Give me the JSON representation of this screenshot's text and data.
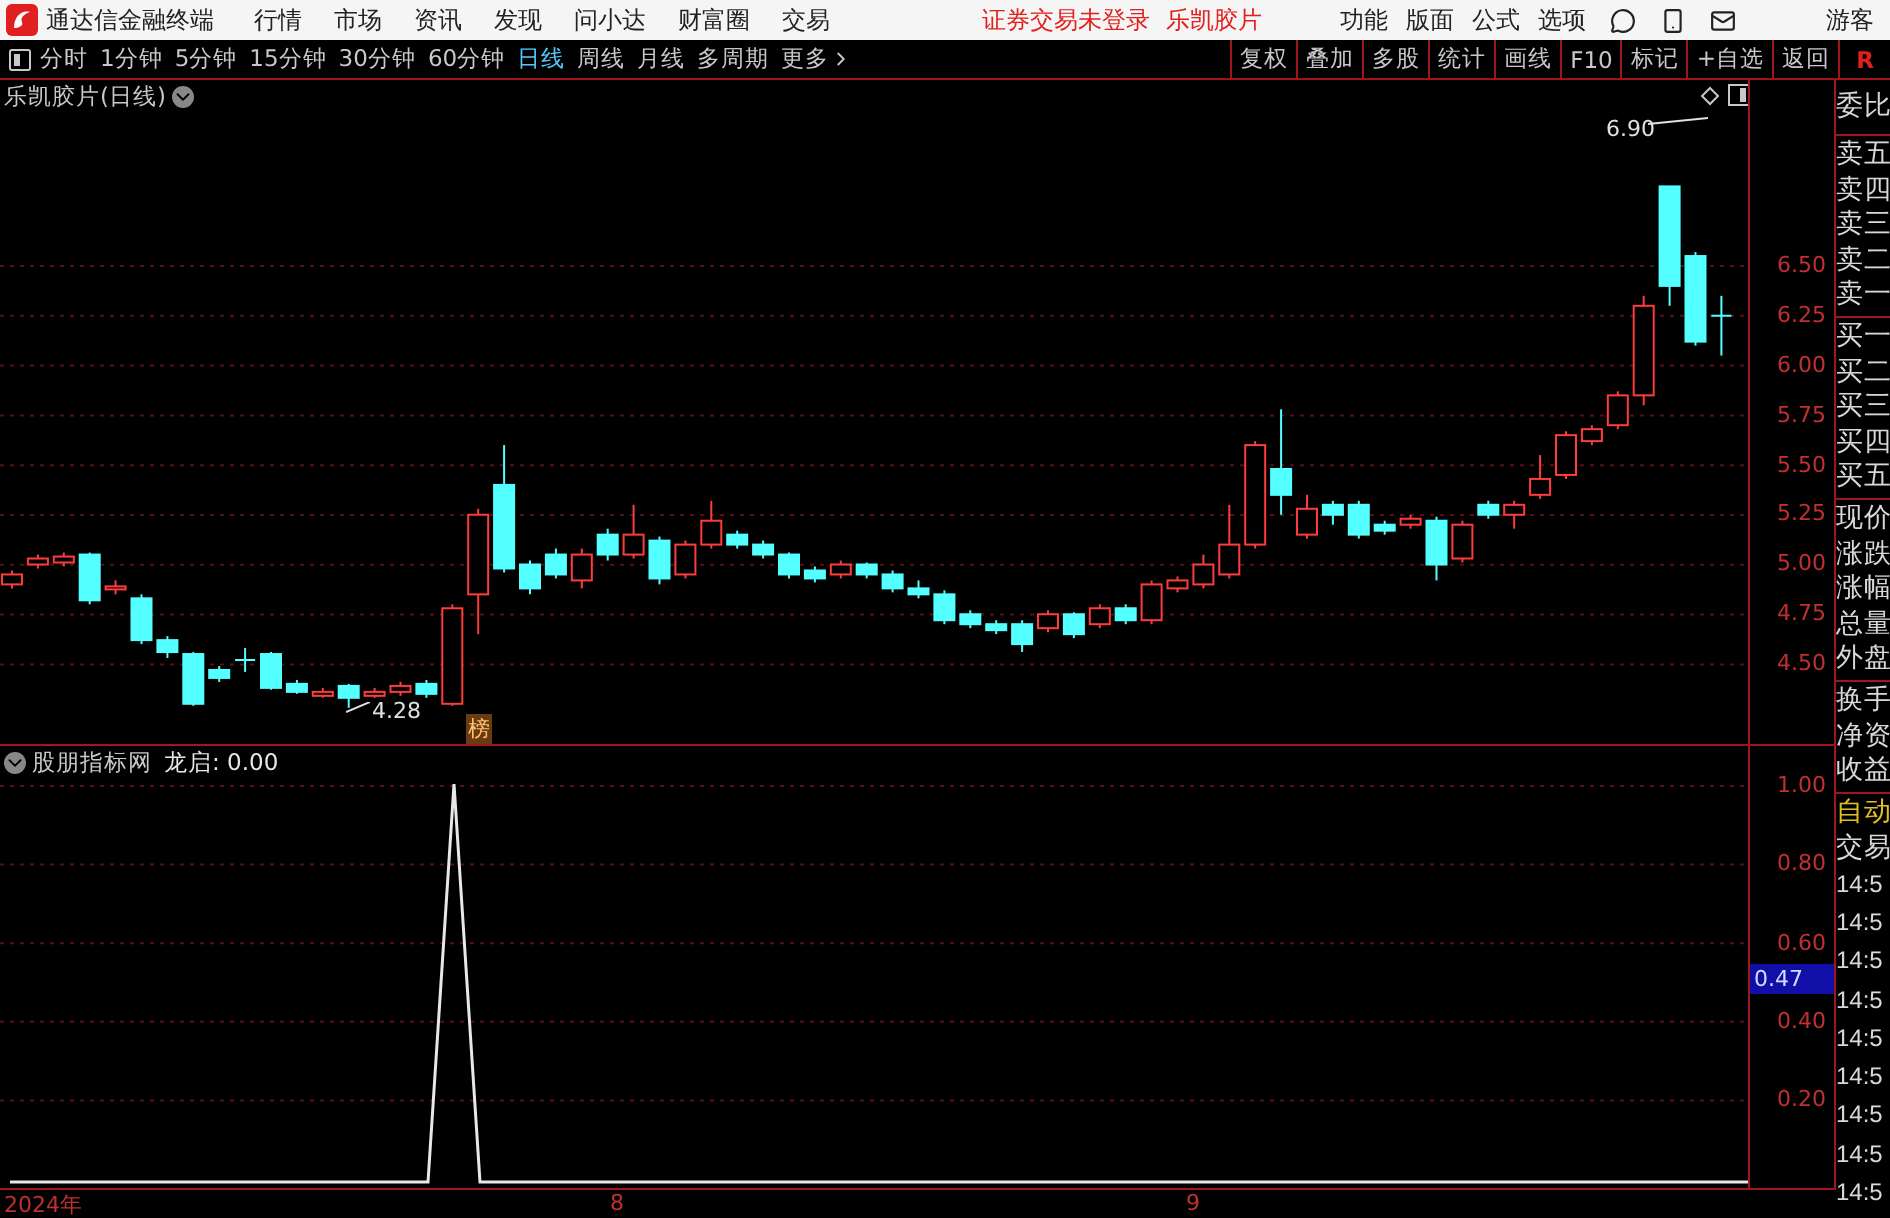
{
  "app": {
    "title": "通达信金融终端"
  },
  "menu": [
    "行情",
    "市场",
    "资讯",
    "发现",
    "问小达",
    "财富圈",
    "交易"
  ],
  "login_status": "证券交易未登录",
  "stock_name": "乐凯胶片",
  "tools": [
    "功能",
    "版面",
    "公式",
    "选项"
  ],
  "user": "游客",
  "periods": [
    {
      "label": "分时",
      "selected": false
    },
    {
      "label": "1分钟",
      "selected": false
    },
    {
      "label": "5分钟",
      "selected": false
    },
    {
      "label": "15分钟",
      "selected": false
    },
    {
      "label": "30分钟",
      "selected": false
    },
    {
      "label": "60分钟",
      "selected": false
    },
    {
      "label": "日线",
      "selected": true
    },
    {
      "label": "周线",
      "selected": false
    },
    {
      "label": "月线",
      "selected": false
    },
    {
      "label": "多周期",
      "selected": false
    }
  ],
  "more": "更多",
  "actions": [
    "复权",
    "叠加",
    "多股",
    "统计",
    "画线",
    "F10",
    "标记",
    "+自选",
    "返回"
  ],
  "mode_badge": "R",
  "main_chart": {
    "title": "乐凯胶片(日线)",
    "high_label": "6.90",
    "low_label": "4.28",
    "marker": "榜",
    "price_ticks": [
      "6.50",
      "6.25",
      "6.00",
      "5.75",
      "5.50",
      "5.25",
      "5.00",
      "4.75",
      "4.50"
    ]
  },
  "indicator": {
    "title": "股朋指标网",
    "reading": "龙启: 0.00",
    "ticks": [
      "1.00",
      "0.80",
      "0.60",
      "0.40",
      "0.20"
    ],
    "cursor_value": "0.47"
  },
  "date_axis": [
    "2024年",
    "8",
    "9"
  ],
  "quote_panel": {
    "groups": [
      [
        "委比"
      ],
      [
        "卖五",
        "卖四",
        "卖三",
        "卖二",
        "卖一"
      ],
      [
        "买一",
        "买二",
        "买三",
        "买四",
        "买五"
      ],
      [
        "现价",
        "涨跌",
        "涨幅",
        "总量",
        "外盘"
      ],
      [
        "换手",
        "净资",
        "收益"
      ]
    ],
    "auto": "自动",
    "trade": "交易",
    "times": [
      "14:5",
      "14:5",
      "14:5",
      "14:5",
      "14:5",
      "14:5",
      "14:5",
      "14:5",
      "14:5"
    ]
  }
}
